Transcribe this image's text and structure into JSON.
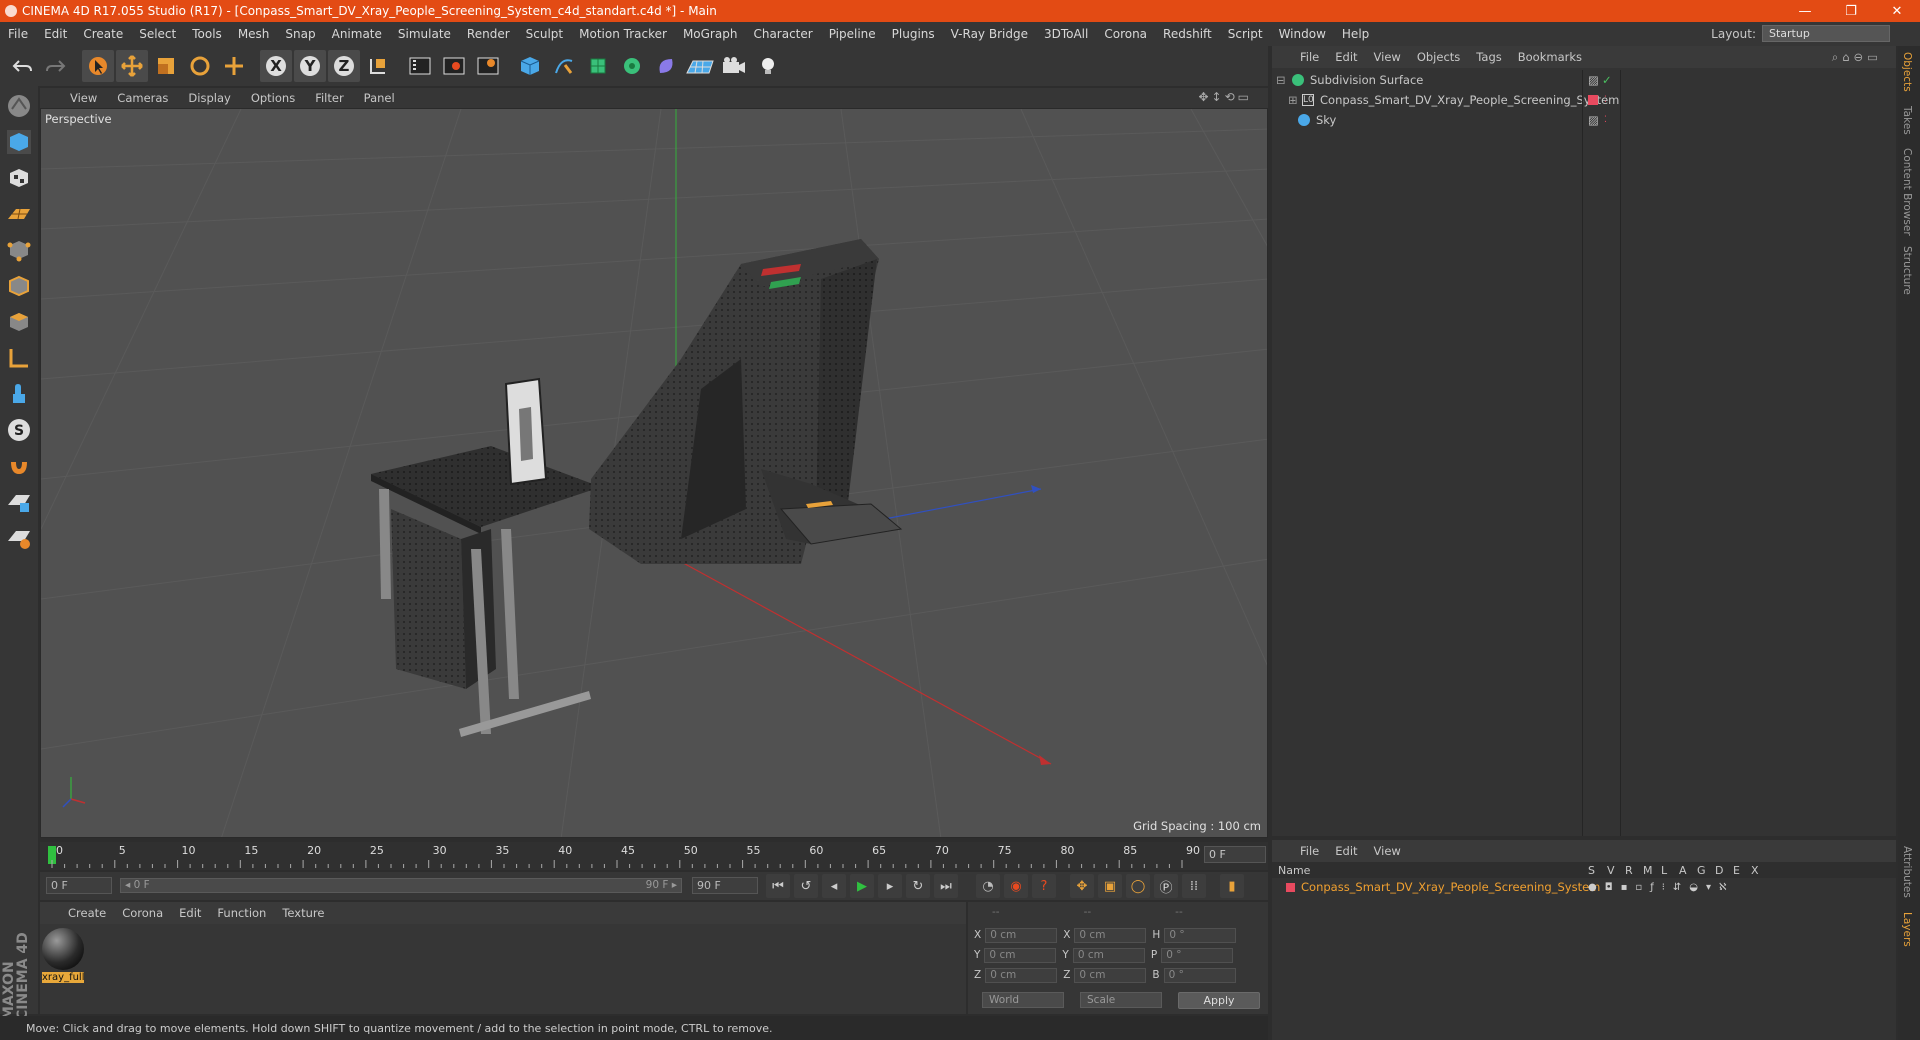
{
  "window": {
    "title": "CINEMA 4D R17.055 Studio (R17) - [Conpass_Smart_DV_Xray_People_Screening_System_c4d_standart.c4d *] - Main",
    "controls": [
      "—",
      "❐",
      "✕"
    ]
  },
  "menubar": {
    "items": [
      "File",
      "Edit",
      "Create",
      "Select",
      "Tools",
      "Mesh",
      "Snap",
      "Animate",
      "Simulate",
      "Render",
      "Sculpt",
      "Motion Tracker",
      "MoGraph",
      "Character",
      "Pipeline",
      "Plugins",
      "V-Ray Bridge",
      "3DToAll",
      "Corona",
      "Redshift",
      "Script",
      "Window",
      "Help"
    ],
    "layout_label": "Layout:",
    "layout_value": "Startup"
  },
  "viewport": {
    "menu": [
      "View",
      "Cameras",
      "Display",
      "Options",
      "Filter",
      "Panel"
    ],
    "camera_label": "Perspective",
    "grid_spacing": "Grid Spacing : 100 cm"
  },
  "timeline": {
    "ticks": [
      "0",
      "5",
      "10",
      "15",
      "20",
      "25",
      "30",
      "35",
      "40",
      "45",
      "50",
      "55",
      "60",
      "65",
      "70",
      "75",
      "80",
      "85",
      "90"
    ],
    "current_frame": "0 F",
    "start_field": "0 F",
    "range_start": "◂ 0 F",
    "range_end": "90 F ▸",
    "end_field": "90 F"
  },
  "material_manager": {
    "menu": [
      "Create",
      "Corona",
      "Edit",
      "Function",
      "Texture"
    ],
    "materials": [
      {
        "name": "xray_full"
      }
    ]
  },
  "coordinates": {
    "header": [
      "--",
      "--",
      "--"
    ],
    "rows": [
      {
        "a": "X",
        "av": "0 cm",
        "b": "X",
        "bv": "0 cm",
        "c": "H",
        "cv": "0 °"
      },
      {
        "a": "Y",
        "av": "0 cm",
        "b": "Y",
        "bv": "0 cm",
        "c": "P",
        "cv": "0 °"
      },
      {
        "a": "Z",
        "av": "0 cm",
        "b": "Z",
        "bv": "0 cm",
        "c": "B",
        "cv": "0 °"
      }
    ],
    "mode1": "World",
    "mode2": "Scale",
    "apply": "Apply"
  },
  "status": "Move: Click and drag to move elements. Hold down SHIFT to quantize movement / add to the selection in point mode, CTRL to remove.",
  "object_manager": {
    "menu": [
      "File",
      "Edit",
      "View",
      "Objects",
      "Tags",
      "Bookmarks"
    ],
    "objects": [
      {
        "name": "Subdivision Surface"
      },
      {
        "name": "Conpass_Smart_DV_Xray_People_Screening_System"
      },
      {
        "name": "Sky"
      }
    ]
  },
  "layer_manager": {
    "menu": [
      "File",
      "Edit",
      "View"
    ],
    "columns": [
      "Name",
      "S",
      "V",
      "R",
      "M",
      "L",
      "A",
      "G",
      "D",
      "E",
      "X"
    ],
    "layers": [
      {
        "name": "Conpass_Smart_DV_Xray_People_Screening_System",
        "color": "#e84a5f"
      }
    ]
  },
  "side_tabs": [
    "Objects",
    "Takes",
    "Content Browser",
    "Structure",
    "Attributes",
    "Layers"
  ],
  "branding": "MAXON CINEMA 4D",
  "colors": {
    "accent": "#e34b14",
    "selected_text": "#f0a030"
  }
}
